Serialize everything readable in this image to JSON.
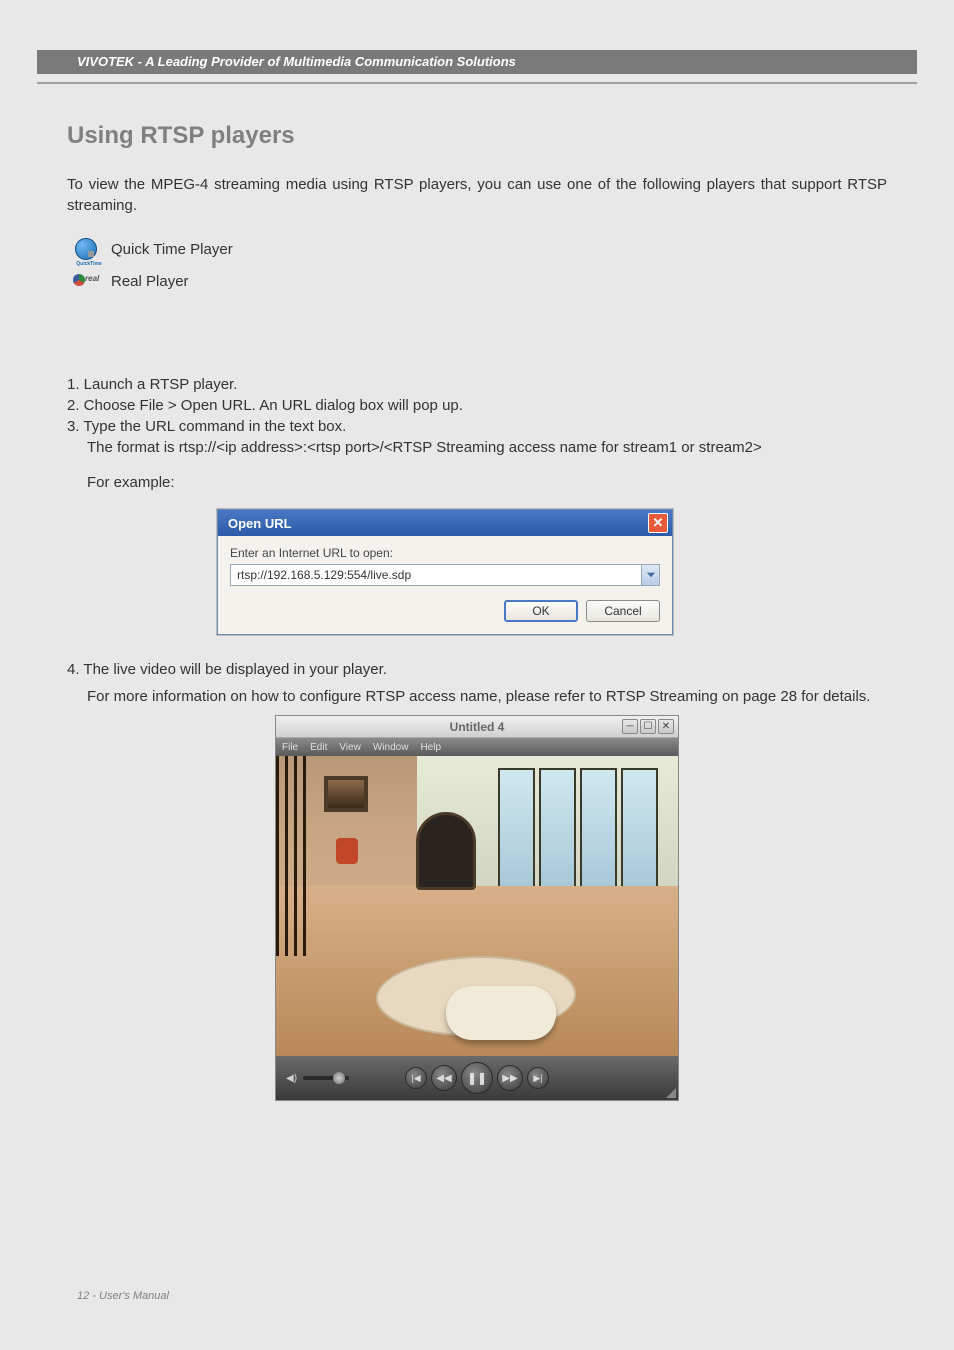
{
  "header": {
    "breadcrumb": "VIVOTEK - A Leading Provider of Multimedia Communication Solutions"
  },
  "section_title": "Using RTSP players",
  "intro": "To view the MPEG-4 streaming media using RTSP players, you can use one of the following players that support RTSP streaming.",
  "players": {
    "quicktime": "Quick Time Player",
    "real": "Real Player"
  },
  "steps": {
    "s1": "1. Launch a RTSP player.",
    "s2": "2. Choose File > Open URL. An URL dialog box will pop up.",
    "s3": "3. Type the URL command in the text box.",
    "s3_detail": "The format is rtsp://<ip address>:<rtsp port>/<RTSP Streaming access name for stream1 or stream2>",
    "for_example": "For example:",
    "s4": "4. The live video will be displayed in your player.",
    "s4_detail": "For more information on how to configure RTSP access name, please refer to RTSP Streaming on page 28 for details."
  },
  "openurl_dialog": {
    "title": "Open URL",
    "label": "Enter an Internet URL to open:",
    "value": "rtsp://192.168.5.129:554/live.sdp",
    "ok": "OK",
    "cancel": "Cancel"
  },
  "player_window": {
    "title": "Untitled 4",
    "menu": {
      "file": "File",
      "edit": "Edit",
      "view": "View",
      "window": "Window",
      "help": "Help"
    }
  },
  "footer": "12 - User's Manual"
}
